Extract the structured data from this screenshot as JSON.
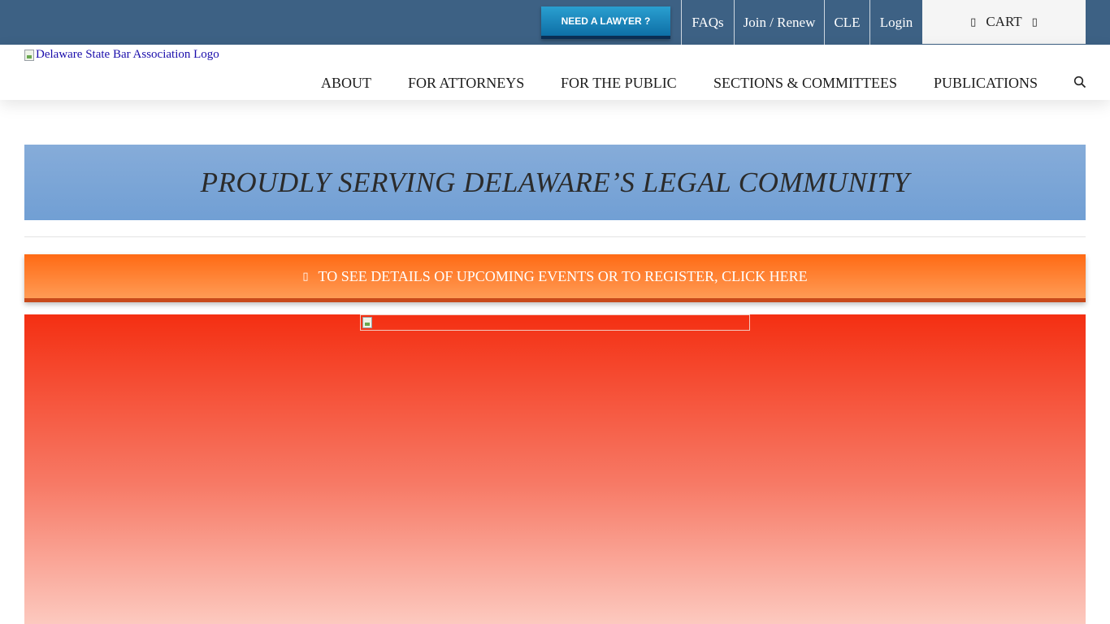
{
  "topbar": {
    "need_lawyer": "NEED A LAWYER ?",
    "links": [
      "FAQs",
      "Join / Renew",
      "CLE",
      "Login"
    ],
    "cart_label": "CART",
    "background": "#3d6184"
  },
  "header": {
    "logo_alt": "Delaware State Bar Association Logo",
    "nav": [
      "ABOUT",
      "FOR ATTORNEYS",
      "FOR THE PUBLIC",
      "SECTIONS & COMMITTEES",
      "PUBLICATIONS"
    ],
    "search_icon": "search-icon"
  },
  "tagline": {
    "text": "PROUDLY SERVING DELAWARE’S LEGAL COMMUNITY",
    "background": "#7ea6d8"
  },
  "events": {
    "text": "TO SEE DETAILS OF UPCOMING EVENTS OR TO REGISTER, CLICK HERE",
    "icon": "calendar-icon",
    "background": "#ff7a2a"
  },
  "hero": {
    "gradient_top": "#f42f12",
    "gradient_bottom": "#fcc9bf"
  }
}
